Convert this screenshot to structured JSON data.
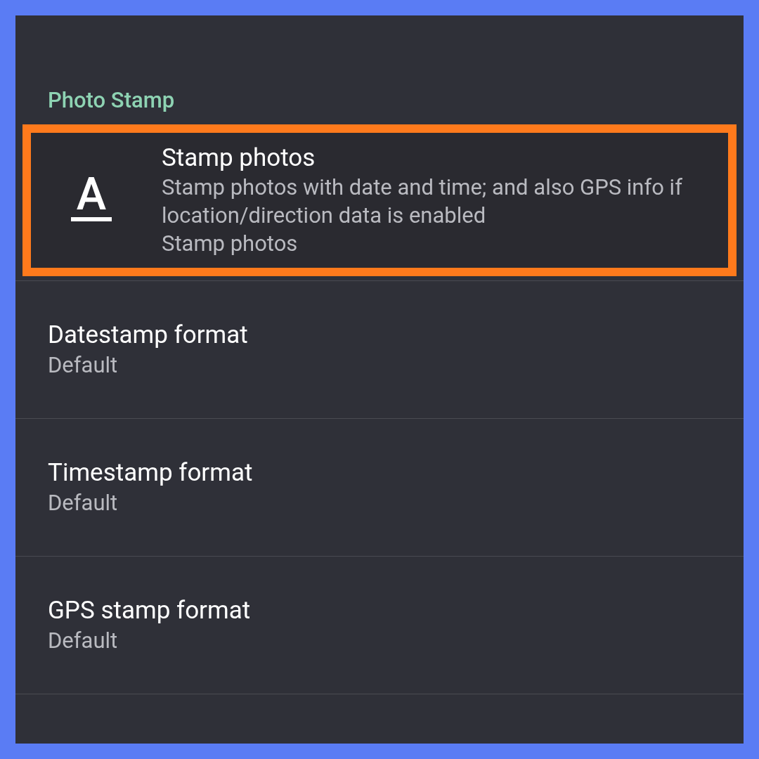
{
  "section": {
    "title": "Photo Stamp"
  },
  "items": [
    {
      "kind": "icon",
      "title": "Stamp photos",
      "summary": "Stamp photos with date and time; and also GPS info if location/direction data is enabled",
      "value": "Stamp photos",
      "icon_letter": "A",
      "highlighted": true
    },
    {
      "kind": "plain",
      "title": "Datestamp format",
      "value": "Default",
      "highlighted": false
    },
    {
      "kind": "plain",
      "title": "Timestamp format",
      "value": "Default",
      "highlighted": false
    },
    {
      "kind": "plain",
      "title": "GPS stamp format",
      "value": "Default",
      "highlighted": false
    }
  ]
}
